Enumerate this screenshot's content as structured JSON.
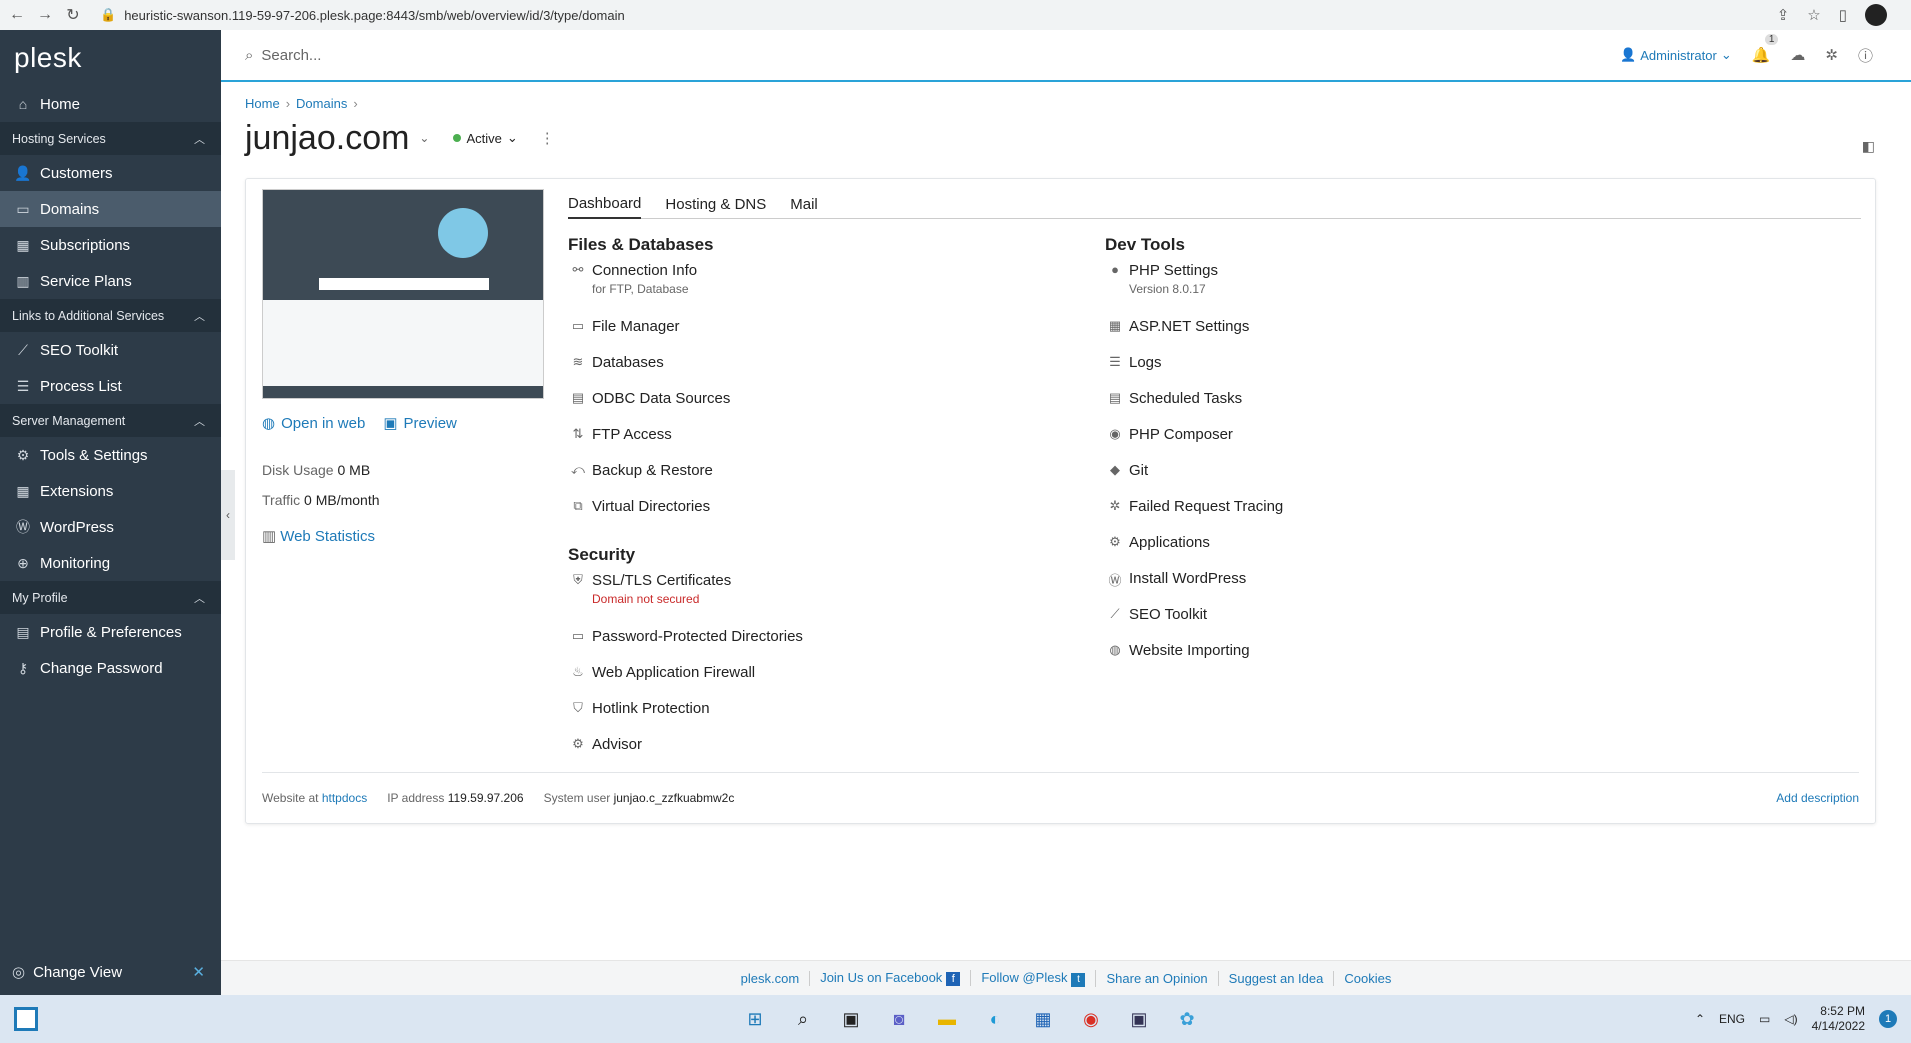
{
  "browser": {
    "url": "heuristic-swanson.119-59-97-206.plesk.page:8443/smb/web/overview/id/3/type/domain"
  },
  "sidebar": {
    "logo": "plesk",
    "home": "Home",
    "groups": {
      "hosting": "Hosting Services",
      "links": "Links to Additional Services",
      "server": "Server Management",
      "profile": "My Profile"
    },
    "items": {
      "customers": "Customers",
      "domains": "Domains",
      "subscriptions": "Subscriptions",
      "service_plans": "Service Plans",
      "seo_toolkit": "SEO Toolkit",
      "process_list": "Process List",
      "tools_settings": "Tools & Settings",
      "extensions": "Extensions",
      "wordpress": "WordPress",
      "monitoring": "Monitoring",
      "profile_prefs": "Profile & Preferences",
      "change_password": "Change Password"
    },
    "change_view": "Change View"
  },
  "topbar": {
    "search_placeholder": "Search...",
    "admin": "Administrator",
    "notif_count": "1"
  },
  "breadcrumb": {
    "home": "Home",
    "domains": "Domains"
  },
  "domain": {
    "name": "junjao.com",
    "status": "Active"
  },
  "overview": {
    "open_in_web": "Open in web",
    "preview": "Preview",
    "disk_label": "Disk Usage",
    "disk_value": "0 MB",
    "traffic_label": "Traffic",
    "traffic_value": "0 MB/month",
    "web_stats": "Web Statistics"
  },
  "tabs": {
    "dashboard": "Dashboard",
    "hosting": "Hosting & DNS",
    "mail": "Mail"
  },
  "files": {
    "title": "Files & Databases",
    "connection": "Connection Info",
    "connection_sub": "for FTP, Database",
    "file_manager": "File Manager",
    "databases": "Databases",
    "odbc": "ODBC Data Sources",
    "ftp": "FTP Access",
    "backup": "Backup & Restore",
    "virtual_dirs": "Virtual Directories"
  },
  "security": {
    "title": "Security",
    "ssl": "SSL/TLS Certificates",
    "ssl_sub": "Domain not secured",
    "pwd_dirs": "Password-Protected Directories",
    "waf": "Web Application Firewall",
    "hotlink": "Hotlink Protection",
    "advisor": "Advisor"
  },
  "devtools": {
    "title": "Dev Tools",
    "php": "PHP Settings",
    "php_sub": "Version 8.0.17",
    "aspnet": "ASP.NET Settings",
    "logs": "Logs",
    "scheduled": "Scheduled Tasks",
    "composer": "PHP Composer",
    "git": "Git",
    "failed": "Failed Request Tracing",
    "apps": "Applications",
    "install_wp": "Install WordPress",
    "seo": "SEO Toolkit",
    "importing": "Website Importing"
  },
  "card_footer": {
    "website_at": "Website at",
    "httpdocs": "httpdocs",
    "ip_label": "IP address",
    "ip": "119.59.97.206",
    "user_label": "System user",
    "user": "junjao.c_zzfkuabmw2c",
    "add_description": "Add description"
  },
  "footer": {
    "plesk": "plesk.com",
    "facebook": "Join Us on Facebook",
    "follow": "Follow @Plesk",
    "opinion": "Share an Opinion",
    "idea": "Suggest an Idea",
    "cookies": "Cookies"
  },
  "taskbar": {
    "lang": "ENG",
    "time": "8:52 PM",
    "date": "4/14/2022",
    "notif": "1"
  }
}
